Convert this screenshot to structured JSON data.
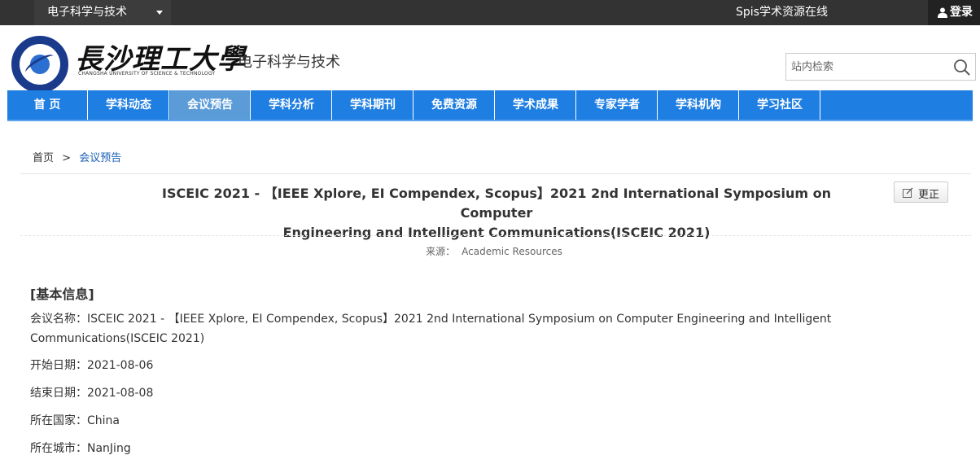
{
  "topbar": {
    "site_selector": "电子科学与技术",
    "resource_link": "Spis学术资源在线",
    "login": "登录"
  },
  "header": {
    "logo_name": "長沙理工大學",
    "logo_english": "CHANGSHA UNIVERSITY OF SCIENCE & TECHNOLOGY",
    "site_title": "电子科学与技术",
    "search_placeholder": "站内检索"
  },
  "nav": {
    "items": [
      "首 页",
      "学科动态",
      "会议预告",
      "学科分析",
      "学科期刊",
      "免费资源",
      "学术成果",
      "专家学者",
      "学科机构",
      "学习社区"
    ],
    "active_index": 2
  },
  "breadcrumb": {
    "home": "首页",
    "separator": ">",
    "current": "会议预告"
  },
  "article": {
    "title_line1": "ISCEIC 2021 - 【IEEE Xplore, EI Compendex, Scopus】2021 2nd International Symposium on Computer",
    "title_line2": "Engineering and Intelligent Communications(ISCEIC 2021)",
    "correct_button": "更正",
    "source_label": "来源：",
    "source_value": "Academic Resources"
  },
  "info": {
    "heading": "[基本信息]",
    "rows": [
      {
        "label": "会议名称：",
        "value": "ISCEIC 2021 - 【IEEE Xplore, EI Compendex, Scopus】2021 2nd International Symposium on Computer Engineering and Intelligent Communications(ISCEIC 2021)"
      },
      {
        "label": "开始日期：",
        "value": "2021-08-06"
      },
      {
        "label": "结束日期：",
        "value": "2021-08-08"
      },
      {
        "label": "所在国家：",
        "value": "China"
      },
      {
        "label": "所在城市：",
        "value": "NanJing"
      }
    ]
  },
  "colors": {
    "nav_bg": "#1e7ee1",
    "nav_active": "#5a9bd8",
    "topbar_bg": "#333333"
  }
}
